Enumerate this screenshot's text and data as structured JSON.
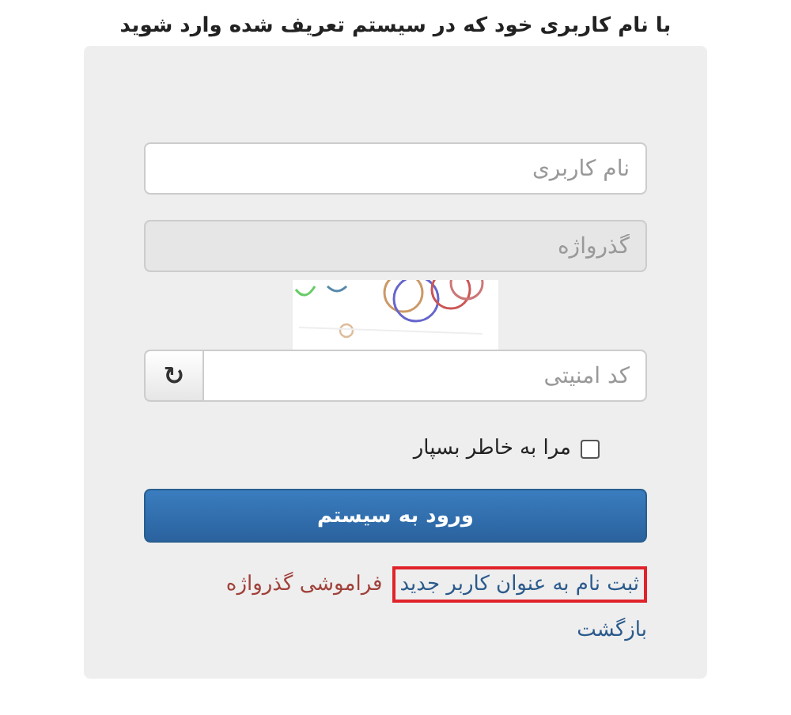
{
  "heading": "با نام کاربری خود که در سیستم تعریف شده وارد شوید",
  "form": {
    "fields": [
      {
        "placeholder": "نام کاربری",
        "disabled": false
      },
      {
        "placeholder": "گذرواژه",
        "disabled": true
      }
    ],
    "security_field": {
      "placeholder": "کد امنیتی",
      "refresh": "↻"
    },
    "remember_me": {
      "label": "مرا به خاطر بسپار",
      "checked": false
    },
    "login_button": "ورود به سیستم",
    "links": [
      {
        "label": "ثبت نام به عنوان کاربر جدید",
        "highlighted": true,
        "color": "#2a5a8c"
      },
      {
        "label": "فراموشی گذرواژه",
        "highlighted": false,
        "color": "#a0413a"
      }
    ],
    "back_link": "بازگشت"
  }
}
